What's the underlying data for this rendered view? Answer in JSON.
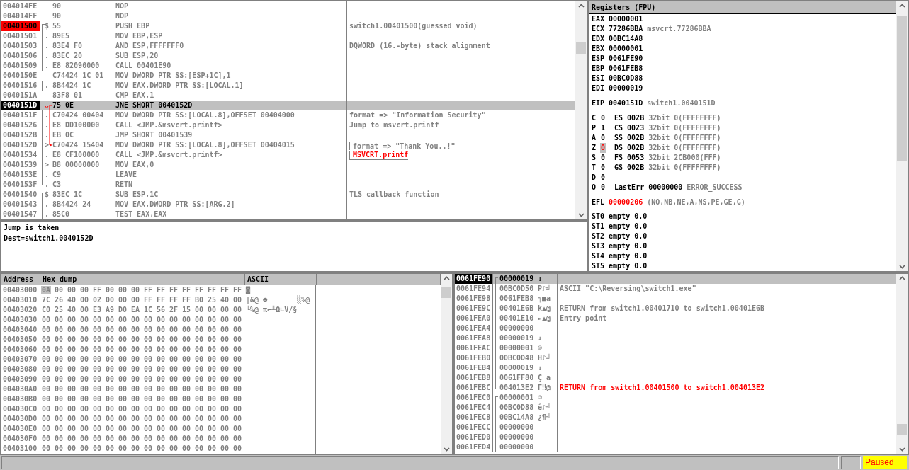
{
  "disassembly": {
    "rows": [
      {
        "address": "004014FE",
        "hex": "90",
        "instruction": "NOP",
        "selected": false
      },
      {
        "address": "004014FF",
        "hex": "90",
        "instruction": "NOP",
        "selected": false
      },
      {
        "address": "00401500",
        "marker": "$",
        "function_start": true,
        "hex": "55",
        "instruction": "PUSH EBP",
        "comment": "switch1.00401500(guessed void)",
        "breakpoint": true,
        "selected": false
      },
      {
        "address": "00401501",
        "marker": ".",
        "function_body": true,
        "hex": "89E5",
        "instruction": "MOV EBP,ESP",
        "selected": false
      },
      {
        "address": "00401503",
        "marker": ".",
        "function_body": true,
        "hex": "83E4 F0",
        "instruction": "AND ESP,FFFFFFF0",
        "comment": "DQWORD (16.-byte) stack alignment",
        "selected": false
      },
      {
        "address": "00401506",
        "marker": ".",
        "function_body": true,
        "hex": "83EC 20",
        "instruction": "SUB ESP,20",
        "selected": false
      },
      {
        "address": "00401509",
        "marker": ".",
        "function_body": true,
        "hex": "E8 82090000",
        "instruction": "CALL 00401E90",
        "selected": false
      },
      {
        "address": "0040150E",
        "hex": "C74424 1C 01",
        "instruction": "MOV DWORD PTR SS:[ESP+1C],1",
        "selected": false
      },
      {
        "address": "00401516",
        "marker": ".",
        "function_body": true,
        "hex": "8B4424 1C",
        "instruction": "MOV EAX,DWORD PTR SS:[LOCAL.1]",
        "selected": false
      },
      {
        "address": "0040151A",
        "hex": "83F8 01",
        "instruction": "CMP EAX,1",
        "selected": false
      },
      {
        "address": "0040151D",
        "hex": "75 0E",
        "instruction": "JNE SHORT 0040152D",
        "current": true,
        "jump_source": true,
        "selected": true
      },
      {
        "address": "0040151F",
        "marker": ".",
        "function_body": true,
        "hex": "C70424 00404",
        "instruction": "MOV DWORD PTR SS:[LOCAL.8],OFFSET 00404000",
        "comment": "format => \"Information Security\"",
        "selected": false
      },
      {
        "address": "00401526",
        "marker": ".",
        "function_body": true,
        "hex": "E8 DD100000",
        "instruction": "CALL <JMP.&msvcrt.printf>",
        "comment": "Jump to msvcrt.printf",
        "selected": false
      },
      {
        "address": "0040152B",
        "marker": ".",
        "function_body": true,
        "hex": "EB 0C",
        "instruction": "JMP SHORT 00401539",
        "selected": false
      },
      {
        "address": "0040152D",
        "marker": ">",
        "function_body": true,
        "hex": "C70424 15404",
        "instruction": "MOV DWORD PTR SS:[LOCAL.8],OFFSET 00404015",
        "comment": "format => \"Thank You..!\"",
        "arg_start": true,
        "jump_target": true,
        "selected": false
      },
      {
        "address": "00401534",
        "marker": ".",
        "function_body": true,
        "hex": "E8 CF100000",
        "instruction": "CALL <JMP.&msvcrt.printf>",
        "comment": "MSVCRT.printf",
        "arg_end": true,
        "selected": false
      },
      {
        "address": "00401539",
        "marker": ">",
        "function_body": true,
        "hex": "B8 00000000",
        "instruction": "MOV EAX,0",
        "selected": false
      },
      {
        "address": "0040153E",
        "marker": ".",
        "function_body": true,
        "hex": "C9",
        "instruction": "LEAVE",
        "selected": false
      },
      {
        "address": "0040153F",
        "marker": ".",
        "function_end": true,
        "hex": "C3",
        "instruction": "RETN",
        "selected": false
      },
      {
        "address": "00401540",
        "marker": "$",
        "function_start": true,
        "hex": "83EC 1C",
        "instruction": "SUB ESP,1C",
        "comment": "TLS callback function",
        "selected": false
      },
      {
        "address": "00401543",
        "marker": ".",
        "function_body": true,
        "hex": "8B4424 24",
        "instruction": "MOV EAX,DWORD PTR SS:[ARG.2]",
        "selected": false
      },
      {
        "address": "00401547",
        "marker": ".",
        "function_body": true,
        "hex": "85C0",
        "instruction": "TEST EAX,EAX",
        "selected": false
      }
    ]
  },
  "info": [
    "Jump is taken",
    "Dest=switch1.0040152D"
  ],
  "registers": {
    "title": "Registers (FPU)",
    "general": [
      {
        "name": "EAX",
        "value": "00000001"
      },
      {
        "name": "ECX",
        "value": "77286BBA",
        "comment": "msvcrt.77286BBA"
      },
      {
        "name": "EDX",
        "value": "00BC14A8"
      },
      {
        "name": "EBX",
        "value": "00000001"
      },
      {
        "name": "ESP",
        "value": "0061FE90"
      },
      {
        "name": "EBP",
        "value": "0061FEB8"
      },
      {
        "name": "ESI",
        "value": "00BC0D88"
      },
      {
        "name": "EDI",
        "value": "00000019"
      }
    ],
    "eip": {
      "name": "EIP",
      "value": "0040151D",
      "comment": "switch1.0040151D"
    },
    "flags": [
      {
        "flag": "C",
        "value": "0",
        "changed": false,
        "segment": "ES",
        "selector": "002B",
        "info": "32bit 0(FFFFFFFF)"
      },
      {
        "flag": "P",
        "value": "1",
        "changed": false,
        "segment": "CS",
        "selector": "0023",
        "info": "32bit 0(FFFFFFFF)"
      },
      {
        "flag": "A",
        "value": "0",
        "changed": false,
        "segment": "SS",
        "selector": "002B",
        "info": "32bit 0(FFFFFFFF)"
      },
      {
        "flag": "Z",
        "value": "0",
        "changed": true,
        "segment": "DS",
        "selector": "002B",
        "info": "32bit 0(FFFFFFFF)"
      },
      {
        "flag": "S",
        "value": "0",
        "changed": false,
        "segment": "FS",
        "selector": "0053",
        "info": "32bit 2CB000(FFF)"
      },
      {
        "flag": "T",
        "value": "0",
        "changed": false,
        "segment": "GS",
        "selector": "002B",
        "info": "32bit 0(FFFFFFFF)"
      },
      {
        "flag": "D",
        "value": "0",
        "changed": false
      },
      {
        "flag": "O",
        "value": "0",
        "changed": false,
        "segment": "LastErr",
        "selector": "00000000",
        "info": "ERROR_SUCCESS"
      }
    ],
    "efl": {
      "name": "EFL",
      "value": "00000206",
      "changed": true,
      "info": "(NO,NB,NE,A,NS,PE,GE,G)"
    },
    "fpu": [
      {
        "name": "ST0",
        "tag": "empty",
        "value": "0.0"
      },
      {
        "name": "ST1",
        "tag": "empty",
        "value": "0.0"
      },
      {
        "name": "ST2",
        "tag": "empty",
        "value": "0.0"
      },
      {
        "name": "ST3",
        "tag": "empty",
        "value": "0.0"
      },
      {
        "name": "ST4",
        "tag": "empty",
        "value": "0.0"
      },
      {
        "name": "ST5",
        "tag": "empty",
        "value": "0.0"
      }
    ]
  },
  "dump": {
    "columns": [
      "Address",
      "Hex dump",
      "ASCII"
    ],
    "rows": [
      {
        "address": "00403000",
        "bytes": [
          "0A",
          "00",
          "00",
          "00",
          "FF",
          "00",
          "00",
          "00",
          "FF",
          "FF",
          "FF",
          "FF",
          "FF",
          "FF",
          "FF",
          "FF"
        ],
        "ascii": "◙",
        "selected": true
      },
      {
        "address": "00403010",
        "bytes": [
          "7C",
          "26",
          "40",
          "00",
          "02",
          "00",
          "00",
          "00",
          "FF",
          "FF",
          "FF",
          "FF",
          "B0",
          "25",
          "40",
          "00"
        ],
        "ascii": "|&@ ☻       ░%@",
        "selected": false
      },
      {
        "address": "00403020",
        "bytes": [
          "C0",
          "25",
          "40",
          "00",
          "E3",
          "A9",
          "D0",
          "EA",
          "1C",
          "56",
          "2F",
          "15",
          "00",
          "00",
          "00",
          "00"
        ],
        "ascii": "└%@ π⌐╨Ω∟V/§",
        "selected": false
      },
      {
        "address": "00403030",
        "bytes": [
          "00",
          "00",
          "00",
          "00",
          "00",
          "00",
          "00",
          "00",
          "00",
          "00",
          "00",
          "00",
          "00",
          "00",
          "00",
          "00"
        ],
        "selected": false
      },
      {
        "address": "00403040",
        "bytes": [
          "00",
          "00",
          "00",
          "00",
          "00",
          "00",
          "00",
          "00",
          "00",
          "00",
          "00",
          "00",
          "00",
          "00",
          "00",
          "00"
        ],
        "selected": false
      },
      {
        "address": "00403050",
        "bytes": [
          "00",
          "00",
          "00",
          "00",
          "00",
          "00",
          "00",
          "00",
          "00",
          "00",
          "00",
          "00",
          "00",
          "00",
          "00",
          "00"
        ],
        "selected": false
      },
      {
        "address": "00403060",
        "bytes": [
          "00",
          "00",
          "00",
          "00",
          "00",
          "00",
          "00",
          "00",
          "00",
          "00",
          "00",
          "00",
          "00",
          "00",
          "00",
          "00"
        ],
        "selected": false
      },
      {
        "address": "00403070",
        "bytes": [
          "00",
          "00",
          "00",
          "00",
          "00",
          "00",
          "00",
          "00",
          "00",
          "00",
          "00",
          "00",
          "00",
          "00",
          "00",
          "00"
        ],
        "selected": false
      },
      {
        "address": "00403080",
        "bytes": [
          "00",
          "00",
          "00",
          "00",
          "00",
          "00",
          "00",
          "00",
          "00",
          "00",
          "00",
          "00",
          "00",
          "00",
          "00",
          "00"
        ],
        "selected": false
      },
      {
        "address": "00403090",
        "bytes": [
          "00",
          "00",
          "00",
          "00",
          "00",
          "00",
          "00",
          "00",
          "00",
          "00",
          "00",
          "00",
          "00",
          "00",
          "00",
          "00"
        ],
        "selected": false
      },
      {
        "address": "004030A0",
        "bytes": [
          "00",
          "00",
          "00",
          "00",
          "00",
          "00",
          "00",
          "00",
          "00",
          "00",
          "00",
          "00",
          "00",
          "00",
          "00",
          "00"
        ],
        "selected": false
      },
      {
        "address": "004030B0",
        "bytes": [
          "00",
          "00",
          "00",
          "00",
          "00",
          "00",
          "00",
          "00",
          "00",
          "00",
          "00",
          "00",
          "00",
          "00",
          "00",
          "00"
        ],
        "selected": false
      },
      {
        "address": "004030C0",
        "bytes": [
          "00",
          "00",
          "00",
          "00",
          "00",
          "00",
          "00",
          "00",
          "00",
          "00",
          "00",
          "00",
          "00",
          "00",
          "00",
          "00"
        ],
        "selected": false
      },
      {
        "address": "004030D0",
        "bytes": [
          "00",
          "00",
          "00",
          "00",
          "00",
          "00",
          "00",
          "00",
          "00",
          "00",
          "00",
          "00",
          "00",
          "00",
          "00",
          "00"
        ],
        "selected": false
      },
      {
        "address": "004030E0",
        "bytes": [
          "00",
          "00",
          "00",
          "00",
          "00",
          "00",
          "00",
          "00",
          "00",
          "00",
          "00",
          "00",
          "00",
          "00",
          "00",
          "00"
        ],
        "selected": false
      },
      {
        "address": "004030F0",
        "bytes": [
          "00",
          "00",
          "00",
          "00",
          "00",
          "00",
          "00",
          "00",
          "00",
          "00",
          "00",
          "00",
          "00",
          "00",
          "00",
          "00"
        ],
        "selected": false
      },
      {
        "address": "00403100",
        "bytes": [
          "00",
          "00",
          "00",
          "00",
          "00",
          "00",
          "00",
          "00",
          "00",
          "00",
          "00",
          "00",
          "00",
          "00",
          "00",
          "00"
        ],
        "selected": false
      }
    ]
  },
  "stack": {
    "rows": [
      {
        "address": "0061FE90",
        "value": "00000019",
        "ascii": "↓",
        "frame_start": true,
        "selected": true
      },
      {
        "address": "0061FE94",
        "value": "00BC0D50",
        "ascii": "P♪╝",
        "comment": "ASCII \"C:\\Reversing\\switch1.exe\"",
        "highlight": false,
        "frame_body": true,
        "selected": false
      },
      {
        "address": "0061FE98",
        "value": "0061FEB8",
        "ascii": "╕■a",
        "frame_body": true,
        "selected": false
      },
      {
        "address": "0061FE9C",
        "value": "00401E6B",
        "ascii": "k▲@",
        "comment": "RETURN from switch1.00401710 to switch1.00401E6B",
        "highlight": false,
        "frame_body": true,
        "selected": false
      },
      {
        "address": "0061FEA0",
        "value": "00401E10",
        "ascii": "►▲@",
        "comment": "Entry point",
        "highlight": false,
        "frame_body": true,
        "selected": false
      },
      {
        "address": "0061FEA4",
        "value": "00000000",
        "frame_body": true,
        "selected": false
      },
      {
        "address": "0061FEA8",
        "value": "00000019",
        "ascii": "↓",
        "frame_body": true,
        "selected": false
      },
      {
        "address": "0061FEAC",
        "value": "00000001",
        "ascii": "☺",
        "frame_body": true,
        "selected": false
      },
      {
        "address": "0061FEB0",
        "value": "00BC0D48",
        "ascii": "H♪╝",
        "frame_body": true,
        "selected": false
      },
      {
        "address": "0061FEB4",
        "value": "00000019",
        "ascii": "↓",
        "frame_body": true,
        "selected": false
      },
      {
        "address": "0061FEB8",
        "value": "0061FF80",
        "ascii": "Ç a",
        "frame_body": true,
        "selected": false
      },
      {
        "address": "0061FEBC",
        "value": "004013E2",
        "ascii": "Γ‼@",
        "comment": "RETURN from switch1.00401500 to switch1.004013E2",
        "highlight": true,
        "frame_end": true,
        "selected": false
      },
      {
        "address": "0061FEC0",
        "value": "00000001",
        "ascii": "☺",
        "frame_start": true,
        "selected": false
      },
      {
        "address": "0061FEC4",
        "value": "00BC0D88",
        "ascii": "ê♪╝",
        "frame_body": true,
        "selected": false
      },
      {
        "address": "0061FEC8",
        "value": "00BC14A8",
        "ascii": "¿¶╝",
        "frame_body": true,
        "selected": false
      },
      {
        "address": "0061FECC",
        "value": "00000000",
        "frame_body": true,
        "selected": false
      },
      {
        "address": "0061FED0",
        "value": "00000000",
        "frame_body": true,
        "selected": false
      },
      {
        "address": "0061FED4",
        "value": "00000000",
        "frame_body": true,
        "selected": false
      }
    ]
  },
  "status_bar": {
    "state": "Paused"
  }
}
